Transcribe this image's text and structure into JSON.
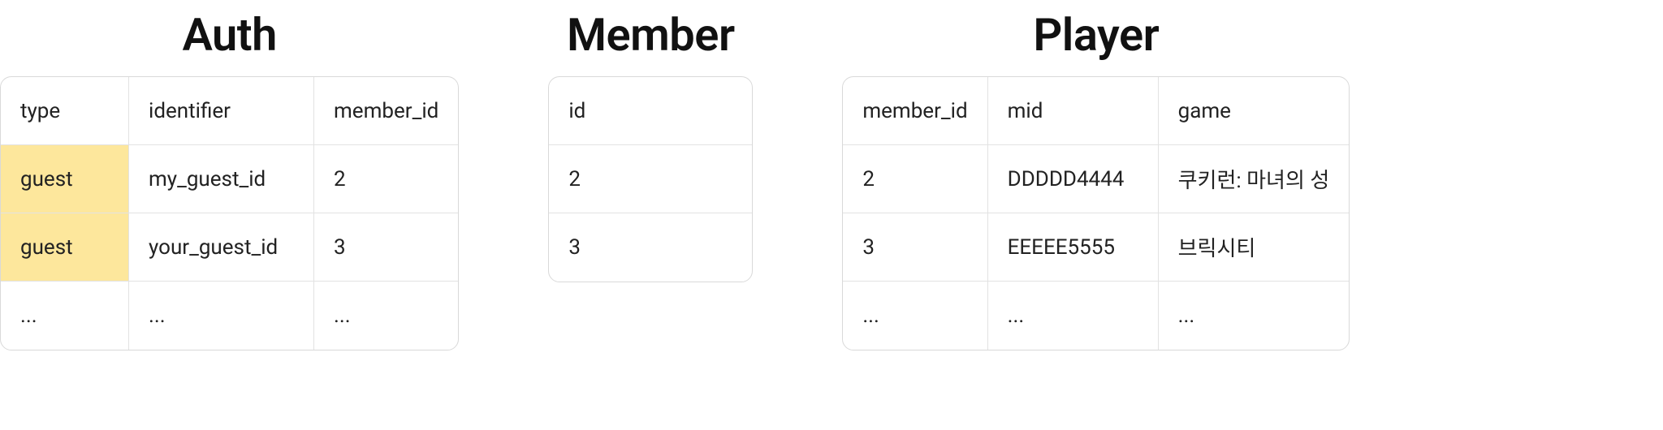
{
  "tables": {
    "auth": {
      "title": "Auth",
      "header": {
        "type": "type",
        "identifier": "identifier",
        "member_id": "member_id"
      },
      "rows": [
        {
          "type": "guest",
          "identifier": "my_guest_id",
          "member_id": "2",
          "type_hl": true
        },
        {
          "type": "guest",
          "identifier": "your_guest_id",
          "member_id": "3",
          "type_hl": true
        },
        {
          "type": "...",
          "identifier": "...",
          "member_id": "...",
          "type_hl": false
        }
      ]
    },
    "member": {
      "title": "Member",
      "header": {
        "id": "id"
      },
      "rows": [
        {
          "id": "2"
        },
        {
          "id": "3"
        }
      ]
    },
    "player": {
      "title": "Player",
      "header": {
        "member_id": "member_id",
        "mid": "mid",
        "game": "game"
      },
      "rows": [
        {
          "member_id": "2",
          "mid": "DDDDD4444",
          "game": "쿠키런: 마녀의 성"
        },
        {
          "member_id": "3",
          "mid": "EEEEE5555",
          "game": "브릭시티"
        },
        {
          "member_id": "...",
          "mid": "...",
          "game": "..."
        }
      ]
    }
  }
}
